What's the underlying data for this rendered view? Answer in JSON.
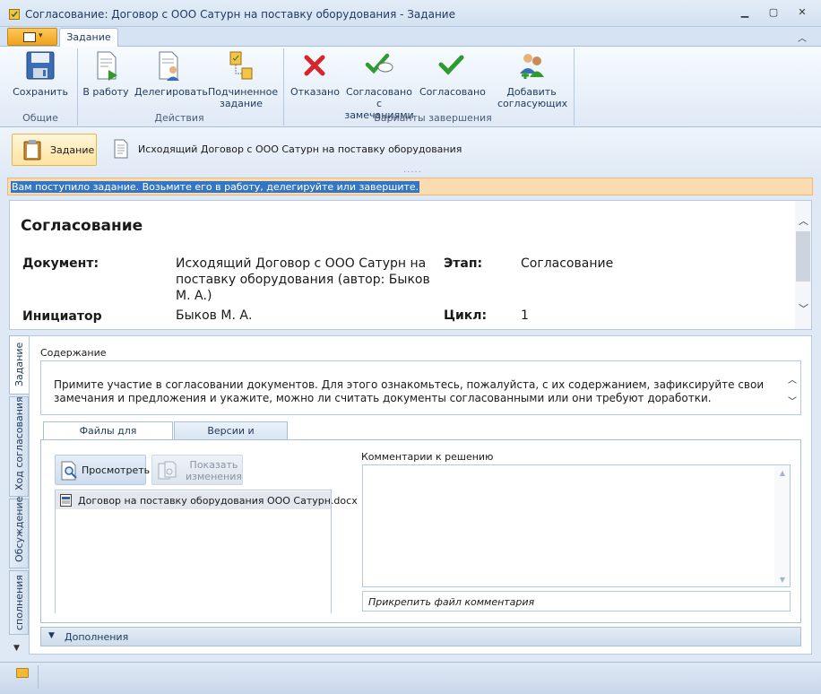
{
  "window": {
    "title": "Согласование: Договор с ООО Сатурн на поставку оборудования - Задание"
  },
  "ribbon": {
    "tab_label": "Задание",
    "groups": {
      "common": "Общие",
      "actions": "Действия",
      "completion": "Варианты завершения"
    },
    "buttons": {
      "save": "Сохранить",
      "in_work": "В работу",
      "delegate": "Делегировать",
      "subordinate_1": "Подчиненное",
      "subordinate_2": "задание",
      "rejected": "Отказано",
      "approved_with_remarks_1": "Согласовано с",
      "approved_with_remarks_2": "замечаниями",
      "approved": "Согласовано",
      "add_approvers_1": "Добавить",
      "add_approvers_2": "согласующих"
    }
  },
  "nav": {
    "task": "Задание",
    "document": "Исходящий Договор с ООО Сатурн на поставку оборудования"
  },
  "infobar": "Вам поступило задание. Возьмите его в работу, делегируйте или завершите.",
  "header": {
    "title": "Согласование",
    "document_key": "Документ:",
    "document_val": "Исходящий Договор с ООО Сатурн на поставку оборудования (автор: Быков М. А.)",
    "stage_key": "Этап:",
    "stage_val": "Согласование",
    "initiator_key": "Инициатор согласования:",
    "initiator_val": "Быков М. А.",
    "cycle_key": "Цикл:",
    "cycle_val": "1"
  },
  "side_tabs": [
    "Задание",
    "Ход согласования",
    "Обсуждение",
    "сполнения"
  ],
  "content": {
    "label": "Содержание",
    "text": "Примите участие в согласовании документов. Для этого ознакомьтесь, пожалуйста, с их содержанием, зафиксируйте свои замечания и предложения и укажите, можно ли считать документы согласованными или они требуют доработки."
  },
  "file_tabs": {
    "files": "Файлы для согласования",
    "versions": "Версии и комментарии"
  },
  "files": {
    "view_button": "Просмотреть",
    "show_changes_1": "Показать",
    "show_changes_2": "изменения",
    "items": [
      "Договор на поставку оборудования ООО Сатурн.docx"
    ]
  },
  "comments": {
    "label": "Комментарии к решению",
    "attach_placeholder": "Прикрепить файл комментария"
  },
  "extras": {
    "label": "Дополнения"
  },
  "colors": {
    "accent": "#fbc85a",
    "reject": "#d9242b",
    "approve": "#2e9b2e",
    "infobar": "#fbdcb1"
  }
}
